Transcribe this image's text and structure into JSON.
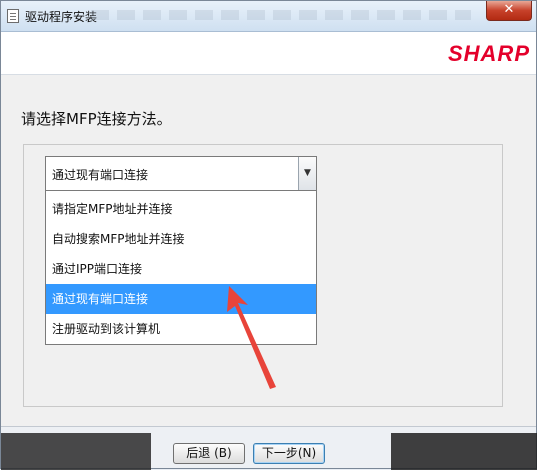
{
  "window": {
    "title": "驱动程序安装",
    "close_label": "✕"
  },
  "header": {
    "logo_text": "SHARP"
  },
  "main": {
    "prompt": "请选择MFP连接方法。",
    "select": {
      "value": "通过现有端口连接",
      "arrow": "▼"
    },
    "options": [
      {
        "label": "请指定MFP地址并连接",
        "selected": false
      },
      {
        "label": "自动搜索MFP地址并连接",
        "selected": false
      },
      {
        "label": "通过IPP端口连接",
        "selected": false
      },
      {
        "label": "通过现有端口连接",
        "selected": true
      },
      {
        "label": "注册驱动到该计算机",
        "selected": false
      }
    ]
  },
  "footer": {
    "back_label": "后退 (B)",
    "next_label": "下一步(N)"
  },
  "colors": {
    "accent": "#3399ff",
    "brand": "#e4002b",
    "annotation_arrow": "#e8443a"
  }
}
